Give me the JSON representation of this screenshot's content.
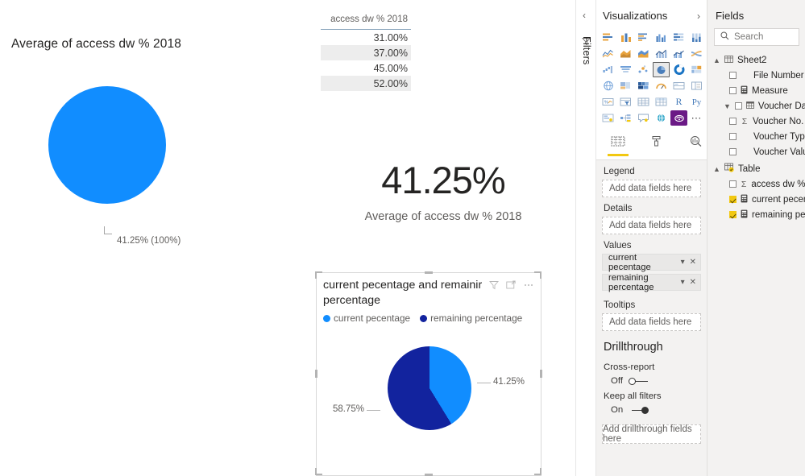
{
  "canvas": {
    "visual_pie_avg": {
      "title": "Average of access dw % 2018",
      "data_label": "41.25% (100%)",
      "slice_color": "#118DFF"
    },
    "visual_table": {
      "column_header": "access dw % 2018",
      "rows": [
        "31.00%",
        "37.00%",
        "45.00%",
        "52.00%"
      ]
    },
    "visual_card": {
      "value": "41.25%",
      "label": "Average of access dw % 2018"
    },
    "visual_pie_selected": {
      "title": "current pecentage and remainir percentage",
      "legend": [
        {
          "label": "current pecentage",
          "color": "#118DFF"
        },
        {
          "label": "remaining percentage",
          "color": "#12239E"
        }
      ],
      "label_right": "41.25%",
      "label_left": "58.75%",
      "header_icons": [
        "filter-icon",
        "focus-mode-icon",
        "more-options-icon"
      ]
    }
  },
  "chart_data": [
    {
      "type": "pie",
      "title": "Average of access dw % 2018",
      "categories": [
        "access dw % 2018"
      ],
      "values": [
        41.25
      ],
      "data_labels": [
        "41.25% (100%)"
      ],
      "colors": [
        "#118DFF"
      ],
      "legend": "none"
    },
    {
      "type": "table",
      "title": "access dw % 2018",
      "columns": [
        "access dw % 2018"
      ],
      "rows": [
        [
          "31.00%"
        ],
        [
          "37.00%"
        ],
        [
          "45.00%"
        ],
        [
          "52.00%"
        ]
      ]
    },
    {
      "type": "pie",
      "title": "current pecentage and remainir percentage",
      "categories": [
        "current pecentage",
        "remaining percentage"
      ],
      "values": [
        41.25,
        58.75
      ],
      "data_labels": [
        "41.25%",
        "58.75%"
      ],
      "colors": [
        "#118DFF",
        "#12239E"
      ],
      "legend": "top"
    }
  ],
  "filters_rail": {
    "collapse_label": "‹",
    "title": "Filters"
  },
  "visualizations": {
    "title": "Visualizations",
    "expand_chevron": "›",
    "tabs": [
      {
        "name": "fields-tab",
        "selected": true
      },
      {
        "name": "format-tab",
        "selected": false
      },
      {
        "name": "analytics-tab",
        "selected": false
      }
    ],
    "buckets": [
      {
        "label": "Legend",
        "placeholder": "Add data fields here",
        "fields": []
      },
      {
        "label": "Details",
        "placeholder": "Add data fields here",
        "fields": []
      },
      {
        "label": "Values",
        "placeholder": null,
        "fields": [
          "current pecentage",
          "remaining percentage"
        ]
      },
      {
        "label": "Tooltips",
        "placeholder": "Add data fields here",
        "fields": []
      }
    ],
    "drillthrough": {
      "title": "Drillthrough",
      "cross_report": {
        "label": "Cross-report",
        "state": "Off"
      },
      "keep_all_filters": {
        "label": "Keep all filters",
        "state": "On"
      },
      "placeholder": "Add drillthrough fields here"
    }
  },
  "fields": {
    "title": "Fields",
    "collapse_chevron": "‹",
    "search_placeholder": "Search",
    "tables": [
      {
        "name": "Sheet2",
        "expanded": true,
        "fields": [
          {
            "label": "File Number",
            "checked": false,
            "icon": "none"
          },
          {
            "label": "Measure",
            "checked": false,
            "icon": "calculator-icon"
          },
          {
            "label": "Voucher Date ...",
            "checked": false,
            "icon": "calendar-icon",
            "expandable": true
          },
          {
            "label": "Voucher No.",
            "checked": false,
            "icon": "sigma-icon"
          },
          {
            "label": "Voucher Type",
            "checked": false,
            "icon": "none"
          },
          {
            "label": "Voucher Value",
            "checked": false,
            "icon": "none"
          }
        ]
      },
      {
        "name": "Table",
        "expanded": true,
        "fields": [
          {
            "label": "access dw % ...",
            "checked": false,
            "icon": "sigma-icon"
          },
          {
            "label": "current pecen...",
            "checked": true,
            "icon": "calculator-icon"
          },
          {
            "label": "remaining per...",
            "checked": true,
            "icon": "calculator-icon"
          }
        ]
      }
    ]
  }
}
